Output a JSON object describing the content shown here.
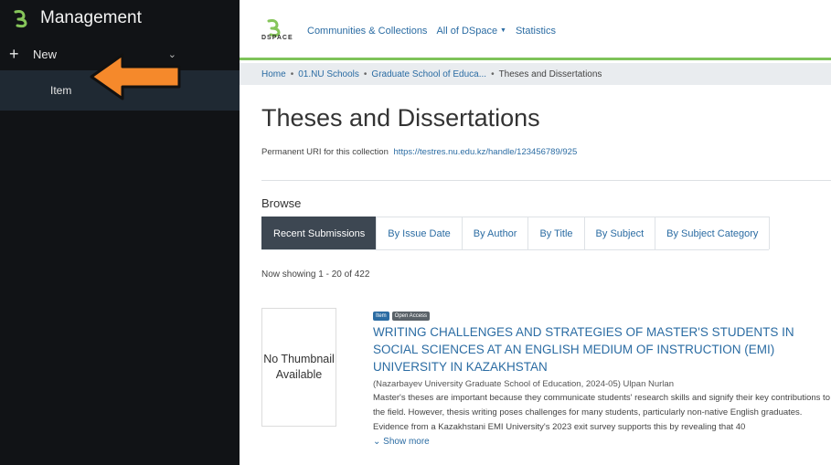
{
  "sidebar": {
    "title": "Management",
    "new_label": "New",
    "item_label": "Item",
    "logo_icon": "dspace-logo-icon",
    "plus_icon": "plus-icon",
    "chevron_icon": "chevron-down-icon",
    "arrow_color": "#f5892b"
  },
  "header": {
    "logo_text": "DSPACE",
    "nav": {
      "communities": "Communities & Collections",
      "all_dspace": "All of DSpace",
      "statistics": "Statistics"
    },
    "accent_color": "#7ec35a"
  },
  "breadcrumb": {
    "home": "Home",
    "schools": "01.NU Schools",
    "graduate": "Graduate School of Educa...",
    "current": "Theses and Dissertations"
  },
  "page": {
    "title": "Theses and Dissertations",
    "uri_label": "Permanent URI for this collection",
    "uri_link": "https://testres.nu.edu.kz/handle/123456789/925",
    "browse_label": "Browse",
    "tabs": [
      "Recent Submissions",
      "By Issue Date",
      "By Author",
      "By Title",
      "By Subject",
      "By Subject Category"
    ],
    "showing": "Now showing 1 - 20 of 422"
  },
  "item": {
    "thumbnail_text": "No Thumbnail Available",
    "badge_item": "Item",
    "badge_access": "Open Access",
    "title": "WRITING CHALLENGES AND STRATEGIES OF MASTER'S STUDENTS IN SOCIAL SCIENCES AT AN ENGLISH MEDIUM OF INSTRUCTION (EMI) UNIVERSITY IN KAZAKHSTAN",
    "meta": "(Nazarbayev University Graduate School of Education, 2024-05) Ulpan Nurlan",
    "abstract": "Master's theses are important because they communicate students' research skills and signify their key contributions to the field. However, thesis writing poses challenges for many students, particularly non-native English graduates. Evidence from a Kazakhstani EMI University's 2023 exit survey supports this by revealing that 40",
    "show_more": "Show more"
  }
}
